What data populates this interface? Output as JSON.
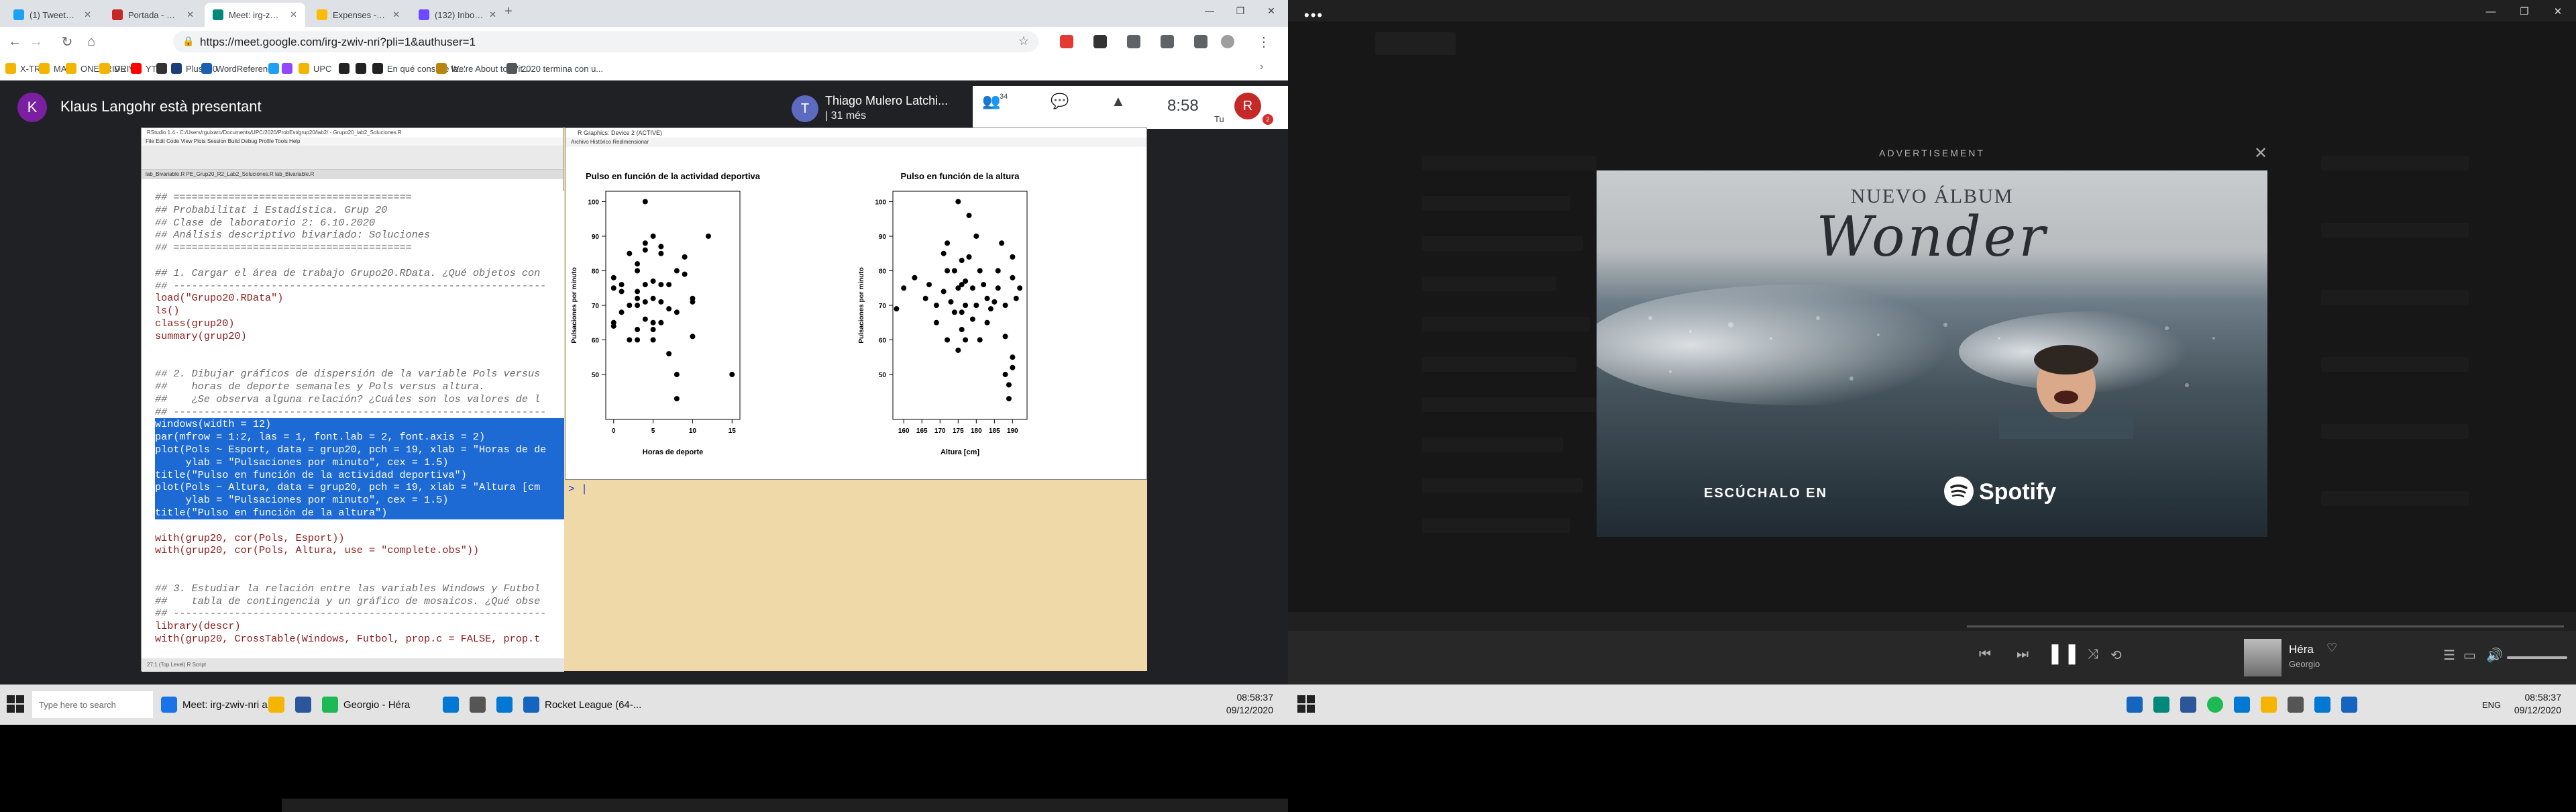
{
  "browser": {
    "tabs": [
      {
        "label": "(1) Tweets más recientes / Twitter",
        "color": "#1da1f2",
        "active": false
      },
      {
        "label": "Portada - Racó de la FIB",
        "color": "#c62828",
        "active": false
      },
      {
        "label": "Meet: irg-zwiv-nri",
        "color": "#00897b",
        "active": true
      },
      {
        "label": "Expenses - Google Drive",
        "color": "#fbbc04",
        "active": false
      },
      {
        "label": "(132) Inbox | rguixaro@protonm...",
        "color": "#6d4aff",
        "active": false
      }
    ],
    "url": "https://meet.google.com/irg-zwiv-nri?pli=1&authuser=1",
    "bookmarks": [
      {
        "label": "X-TRA",
        "color": "#f4b400"
      },
      {
        "label": "MAIL",
        "color": "#f4b400"
      },
      {
        "label": "ONEDRIVE",
        "color": "#f4b400"
      },
      {
        "label": "DRIVE",
        "color": "#f4b400"
      },
      {
        "label": "YT",
        "color": "#ff0000"
      },
      {
        "label": "",
        "color": "#333333"
      },
      {
        "label": "Plus500",
        "color": "#1a3d7c"
      },
      {
        "label": "WordReference",
        "color": "#1a5fb4"
      },
      {
        "label": "",
        "color": "#1da1f2"
      },
      {
        "label": "",
        "color": "#9146ff"
      },
      {
        "label": "UPC",
        "color": "#f4b400"
      },
      {
        "label": "",
        "color": "#222222"
      },
      {
        "label": "",
        "color": "#222222"
      },
      {
        "label": "En qué consiste la...",
        "color": "#222222"
      },
      {
        "label": "We're About to Wit...",
        "color": "#b8860b"
      },
      {
        "label": "2020 termina con u...",
        "color": "#555555"
      }
    ]
  },
  "meet": {
    "presenter_initial": "K",
    "presenter_text": "Klaus Langohr està presentant",
    "participant_initial": "T",
    "participant_name": "Thiago Mulero Latchi...",
    "participant_sub": "| 31 més",
    "participants_count": "34",
    "time": "8:58",
    "self_initial": "R",
    "self_label": "Tu",
    "badge": "2"
  },
  "rstudio": {
    "title": "RStudio 1.4 - C:/Users/rguixaro/Documents/UPC/2020/ProbEst/grup20/lab2/ - Grupo20_lab2_Soluciones.R",
    "menu": "File  Edit  Code  View  Plots  Session  Build  Debug  Profile  Tools  Help",
    "tabs": "lab_Bivariable.R   PE_Grup20_R2_Lab2_Soluciones.R   lab_Bivariable.R",
    "status": "27:1    (Top Level)    R Script",
    "lines": [
      {
        "text": "## =======================================",
        "cls": "com"
      },
      {
        "text": "## Probabilitat i Estadística. Grup 20",
        "cls": "com"
      },
      {
        "text": "## Clase de laboratorio 2: 6.10.2020",
        "cls": "com"
      },
      {
        "text": "## Análisis descriptivo bivariado: Soluciones",
        "cls": "com"
      },
      {
        "text": "## =======================================",
        "cls": "com"
      },
      {
        "text": "",
        "cls": "plain"
      },
      {
        "text": "## 1. Cargar el área de trabajo Grupo20.RData. ¿Qué objetos con",
        "cls": "com"
      },
      {
        "text": "## -------------------------------------------------------------",
        "cls": "com"
      },
      {
        "text": "load(\"Grupo20.RData\")",
        "cls": "fn"
      },
      {
        "text": "ls()",
        "cls": "fn"
      },
      {
        "text": "class(grup20)",
        "cls": "fn"
      },
      {
        "text": "summary(grup20)",
        "cls": "fn"
      },
      {
        "text": "",
        "cls": "plain"
      },
      {
        "text": "",
        "cls": "plain"
      },
      {
        "text": "## 2. Dibujar gráficos de dispersión de la variable Pols versus",
        "cls": "com"
      },
      {
        "text": "##    horas de deporte semanales y Pols versus altura.",
        "cls": "com"
      },
      {
        "text": "##    ¿Se observa alguna relación? ¿Cuáles son los valores de l",
        "cls": "com"
      },
      {
        "text": "## -------------------------------------------------------------",
        "cls": "com"
      },
      {
        "text": "windows(width = 12)",
        "cls": "sel"
      },
      {
        "text": "par(mfrow = 1:2, las = 1, font.lab = 2, font.axis = 2)",
        "cls": "sel"
      },
      {
        "text": "plot(Pols ~ Esport, data = grup20, pch = 19, xlab = \"Horas de de",
        "cls": "sel"
      },
      {
        "text": "     ylab = \"Pulsaciones por minuto\", cex = 1.5)",
        "cls": "sel"
      },
      {
        "text": "title(\"Pulso en función de la actividad deportiva\")",
        "cls": "sel"
      },
      {
        "text": "plot(Pols ~ Altura, data = grup20, pch = 19, xlab = \"Altura [cm",
        "cls": "sel"
      },
      {
        "text": "     ylab = \"Pulsaciones por minuto\", cex = 1.5)",
        "cls": "sel"
      },
      {
        "text": "title(\"Pulso en función de la altura\")",
        "cls": "sel"
      },
      {
        "text": "",
        "cls": "plain"
      },
      {
        "text": "with(grup20, cor(Pols, Esport))",
        "cls": "fn"
      },
      {
        "text": "with(grup20, cor(Pols, Altura, use = \"complete.obs\"))",
        "cls": "fn"
      },
      {
        "text": "",
        "cls": "plain"
      },
      {
        "text": "",
        "cls": "plain"
      },
      {
        "text": "## 3. Estudiar la relación entre las variables Windows y Futbol",
        "cls": "com"
      },
      {
        "text": "##    tabla de contingencia y un gráfico de mosaicos. ¿Qué obse",
        "cls": "com"
      },
      {
        "text": "## -------------------------------------------------------------",
        "cls": "com"
      },
      {
        "text": "library(descr)",
        "cls": "fn"
      },
      {
        "text": "with(grup20, CrossTable(Windows, Futbol, prop.c = FALSE, prop.t",
        "cls": "fn"
      }
    ]
  },
  "graphics_window": {
    "title": "R Graphics: Device 2 (ACTIVE)",
    "menu": "Archivo   Histórico   Redimensionar"
  },
  "console_prompt": "> |",
  "chart_data": [
    {
      "type": "scatter",
      "title": "Pulso en función de la actividad deportiva",
      "xlabel": "Horas de deporte",
      "ylabel": "Pulsaciones por minuto",
      "xlim": [
        -1,
        16
      ],
      "ylim": [
        37,
        103
      ],
      "xticks": [
        0,
        5,
        10,
        15
      ],
      "yticks": [
        50,
        60,
        70,
        80,
        90,
        100
      ],
      "points": [
        [
          0,
          78
        ],
        [
          0,
          75
        ],
        [
          0,
          64
        ],
        [
          0,
          65
        ],
        [
          1,
          74
        ],
        [
          1,
          76
        ],
        [
          1,
          68
        ],
        [
          2,
          85
        ],
        [
          2,
          60
        ],
        [
          2,
          70
        ],
        [
          3,
          60
        ],
        [
          3,
          63
        ],
        [
          3,
          70
        ],
        [
          3,
          74
        ],
        [
          3,
          80
        ],
        [
          3,
          82
        ],
        [
          3,
          72
        ],
        [
          4,
          71
        ],
        [
          4,
          76
        ],
        [
          4,
          86
        ],
        [
          4,
          88
        ],
        [
          4,
          100
        ],
        [
          4,
          66
        ],
        [
          5,
          63
        ],
        [
          5,
          65
        ],
        [
          5,
          72
        ],
        [
          5,
          77
        ],
        [
          5,
          90
        ],
        [
          5,
          60
        ],
        [
          6,
          65
        ],
        [
          6,
          71
        ],
        [
          6,
          76
        ],
        [
          6,
          85
        ],
        [
          6,
          87
        ],
        [
          7,
          56
        ],
        [
          7,
          69
        ],
        [
          7,
          76
        ],
        [
          8,
          68
        ],
        [
          8,
          80
        ],
        [
          9,
          79
        ],
        [
          9,
          84
        ],
        [
          10,
          71
        ],
        [
          10,
          72
        ],
        [
          10,
          61
        ],
        [
          12,
          90
        ],
        [
          8,
          43
        ],
        [
          15,
          50
        ],
        [
          8,
          50
        ]
      ]
    },
    {
      "type": "scatter",
      "title": "Pulso en función de la altura",
      "xlabel": "Altura [cm]",
      "ylabel": "Pulsaciones por minuto",
      "xlim": [
        157,
        194
      ],
      "ylim": [
        37,
        103
      ],
      "xticks": [
        160,
        165,
        170,
        175,
        180,
        185,
        190
      ],
      "yticks": [
        50,
        60,
        70,
        80,
        90,
        100
      ],
      "points": [
        [
          158,
          69
        ],
        [
          160,
          75
        ],
        [
          163,
          78
        ],
        [
          166,
          72
        ],
        [
          167,
          76
        ],
        [
          169,
          65
        ],
        [
          169,
          70
        ],
        [
          171,
          74
        ],
        [
          171,
          85
        ],
        [
          172,
          88
        ],
        [
          172,
          80
        ],
        [
          172,
          60
        ],
        [
          173,
          71
        ],
        [
          174,
          80
        ],
        [
          174,
          68
        ],
        [
          175,
          57
        ],
        [
          175,
          75
        ],
        [
          175,
          100
        ],
        [
          176,
          83
        ],
        [
          176,
          76
        ],
        [
          176,
          63
        ],
        [
          176,
          68
        ],
        [
          177,
          60
        ],
        [
          177,
          77
        ],
        [
          177,
          70
        ],
        [
          178,
          84
        ],
        [
          178,
          96
        ],
        [
          179,
          75
        ],
        [
          179,
          66
        ],
        [
          180,
          70
        ],
        [
          180,
          90
        ],
        [
          181,
          80
        ],
        [
          181,
          60
        ],
        [
          182,
          76
        ],
        [
          183,
          72
        ],
        [
          183,
          65
        ],
        [
          184,
          69
        ],
        [
          185,
          71
        ],
        [
          186,
          80
        ],
        [
          186,
          75
        ],
        [
          187,
          88
        ],
        [
          188,
          70
        ],
        [
          188,
          61
        ],
        [
          189,
          43
        ],
        [
          190,
          52
        ],
        [
          190,
          55
        ],
        [
          190,
          78
        ],
        [
          190,
          84
        ],
        [
          191,
          72
        ],
        [
          192,
          75
        ],
        [
          188,
          50
        ],
        [
          189,
          47
        ]
      ]
    }
  ],
  "taskbar_left": {
    "search": "Type here to search",
    "items": [
      {
        "label": "Meet: irg-zwiv-nri a...",
        "color": "#1a73e8"
      },
      {
        "label": "",
        "color": "#f4b400"
      },
      {
        "label": "",
        "color": "#2b579a"
      },
      {
        "label": "Georgio - Héra",
        "color": "#1db954"
      },
      {
        "label": "",
        "color": "#0078d4"
      },
      {
        "label": "",
        "color": "#555555"
      },
      {
        "label": "",
        "color": "#0078d4"
      },
      {
        "label": "Rocket League (64-...",
        "color": "#1565c0"
      }
    ],
    "time": "08:58:37",
    "date": "09/12/2020"
  },
  "spotify": {
    "ad_label": "ADVERTISEMENT",
    "ad_line1": "NUEVO ÁLBUM",
    "ad_line2": "Wonder",
    "ad_cta": "ESCÚCHALO EN",
    "ad_brand": "Spotify",
    "song": "Héra",
    "artist": "Georgio"
  },
  "taskbar_right": {
    "time": "08:58:37",
    "date": "09/12/2020",
    "lang": "ENG"
  }
}
